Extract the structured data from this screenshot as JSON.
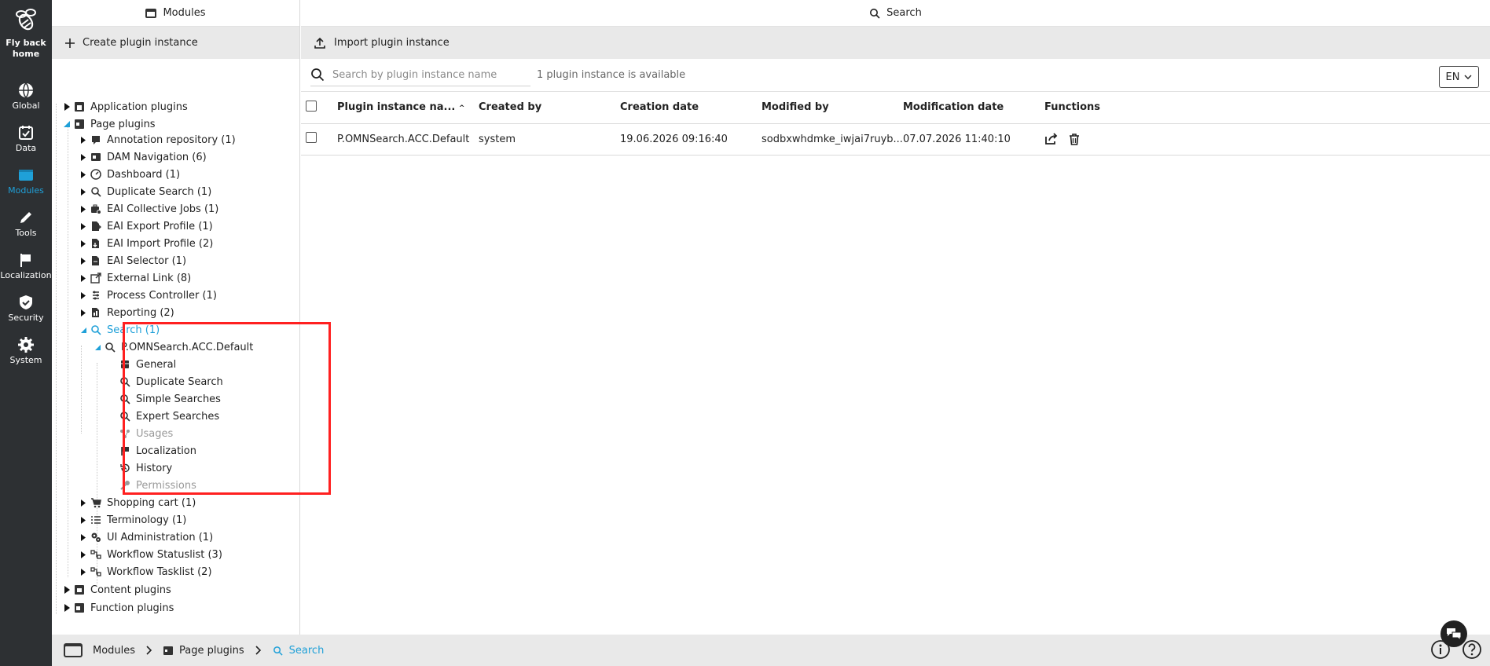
{
  "nav": {
    "logo_label": "Fly back home",
    "items": [
      {
        "label": "Global",
        "icon": "globe-icon"
      },
      {
        "label": "Data",
        "icon": "calendar-check-icon"
      },
      {
        "label": "Modules",
        "icon": "window-icon",
        "active": true
      },
      {
        "label": "Tools",
        "icon": "pencil-icon"
      },
      {
        "label": "Localization",
        "icon": "flag-icon"
      },
      {
        "label": "Security",
        "icon": "shield-icon"
      },
      {
        "label": "System",
        "icon": "gear-icon"
      }
    ]
  },
  "left_panel": {
    "title": "Modules",
    "create_label": "Create plugin instance"
  },
  "tree": {
    "application_plugins": "Application plugins",
    "page_plugins": "Page plugins",
    "annotation": "Annotation repository (1)",
    "dam_navigation": "DAM Navigation (6)",
    "dashboard": "Dashboard (1)",
    "duplicate_search": "Duplicate Search (1)",
    "eai_collective": "EAI Collective Jobs (1)",
    "eai_export": "EAI Export Profile (1)",
    "eai_import": "EAI Import Profile (2)",
    "eai_selector": "EAI Selector (1)",
    "external_link": "External Link (8)",
    "process_controller": "Process Controller (1)",
    "reporting": "Reporting (2)",
    "search": "Search (1)",
    "instance": "P.OMNSearch.ACC.Default",
    "general": "General",
    "sub_duplicate": "Duplicate Search",
    "simple": "Simple Searches",
    "expert": "Expert Searches",
    "usages": "Usages",
    "localization": "Localization",
    "history": "History",
    "permissions": "Permissions",
    "shopping_cart": "Shopping cart (1)",
    "terminology": "Terminology (1)",
    "ui_admin": "UI Administration (1)",
    "wf_statuslist": "Workflow Statuslist (3)",
    "wf_tasklist": "Workflow Tasklist (2)",
    "content_plugins": "Content plugins",
    "function_plugins": "Function plugins"
  },
  "right_panel": {
    "title": "Search",
    "import_label": "Import plugin instance",
    "search_placeholder": "Search by plugin instance name",
    "count_text": "1 plugin instance is available",
    "lang": "EN"
  },
  "table": {
    "headers": {
      "name": "Plugin instance na...",
      "created_by": "Created by",
      "creation_date": "Creation date",
      "modified_by": "Modified by",
      "modification_date": "Modification date",
      "functions": "Functions"
    },
    "rows": [
      {
        "name": "P.OMNSearch.ACC.Default",
        "created_by": "system",
        "creation_date": "19.06.2026 09:16:40",
        "modified_by": "sodbxwhdmke_iwjai7ruyb...",
        "modification_date": "07.07.2026 11:40:10"
      }
    ]
  },
  "footer": {
    "crumb1": "Modules",
    "crumb2": "Page plugins",
    "crumb3": "Search"
  },
  "colors": {
    "accent": "#1fa0d8",
    "nav_bg": "#2d3033",
    "highlight": "#ff2020"
  }
}
